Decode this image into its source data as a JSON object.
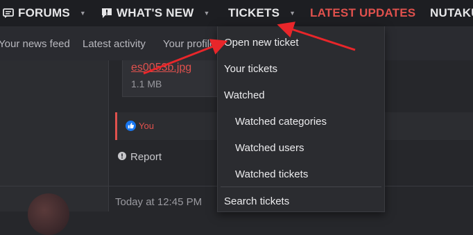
{
  "topnav": {
    "forums": "FORUMS",
    "whats_new": "WHAT'S NEW",
    "tickets": "TICKETS",
    "latest_updates": "LATEST UPDATES",
    "nutaku": "NUTAKU"
  },
  "subnav": {
    "news_feed": "Your news feed",
    "latest_activity": "Latest activity",
    "your_profile": "Your profile"
  },
  "attachment": {
    "filename": "es0053b.jpg",
    "size": "1.1 MB"
  },
  "reaction": {
    "label": "You"
  },
  "report": {
    "label": "Report"
  },
  "post2": {
    "timestamp": "Today at 12:45 PM"
  },
  "dropdown": {
    "items": [
      "Open new ticket",
      "Your tickets",
      "Watched",
      "Watched categories",
      "Watched users",
      "Watched tickets",
      "Search tickets"
    ]
  },
  "colors": {
    "accent": "#e0514d",
    "nav_bg": "#1d1e22",
    "page_bg": "#26272b",
    "dropdown_bg": "#2b2c30",
    "like_blue": "#1877f2"
  },
  "icons": {
    "forums": "chat-lines-icon",
    "whats_new": "comment-exclamation-icon",
    "caret": "caret-down-icon",
    "like": "thumbs-up-icon",
    "report": "exclamation-circle-icon"
  }
}
